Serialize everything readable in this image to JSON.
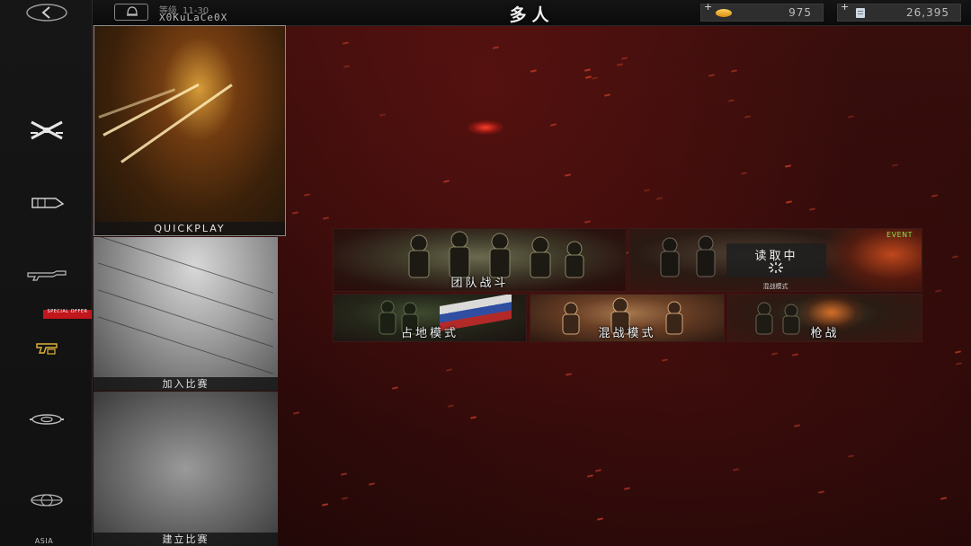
{
  "header": {
    "rank_label": "等级",
    "rank_level": "11-30",
    "player_name": "X0KuLaCe0X",
    "title": "多人",
    "currencies": [
      {
        "name": "gold",
        "value": "975"
      },
      {
        "name": "credits",
        "value": "26,395"
      }
    ]
  },
  "nav": {
    "special_offer": "SPECIAL OFFER",
    "region": "ASIA"
  },
  "mode_tiles": [
    {
      "id": "quickplay",
      "label": "QUICKPLAY"
    },
    {
      "id": "join-match",
      "label": "加入比赛"
    },
    {
      "id": "create-match",
      "label": "建立比赛"
    }
  ],
  "game_modes": {
    "team_deathmatch": "团队战斗",
    "event": {
      "badge": "EVENT",
      "loading": "读取中",
      "sublabel": "混战模式"
    },
    "domination": "占地模式",
    "free_for_all": "混战模式",
    "gunfight": "枪战"
  },
  "colors": {
    "background": "#2a0a09",
    "event_badge": "#8de14a",
    "special_offer": "#c1161c"
  }
}
